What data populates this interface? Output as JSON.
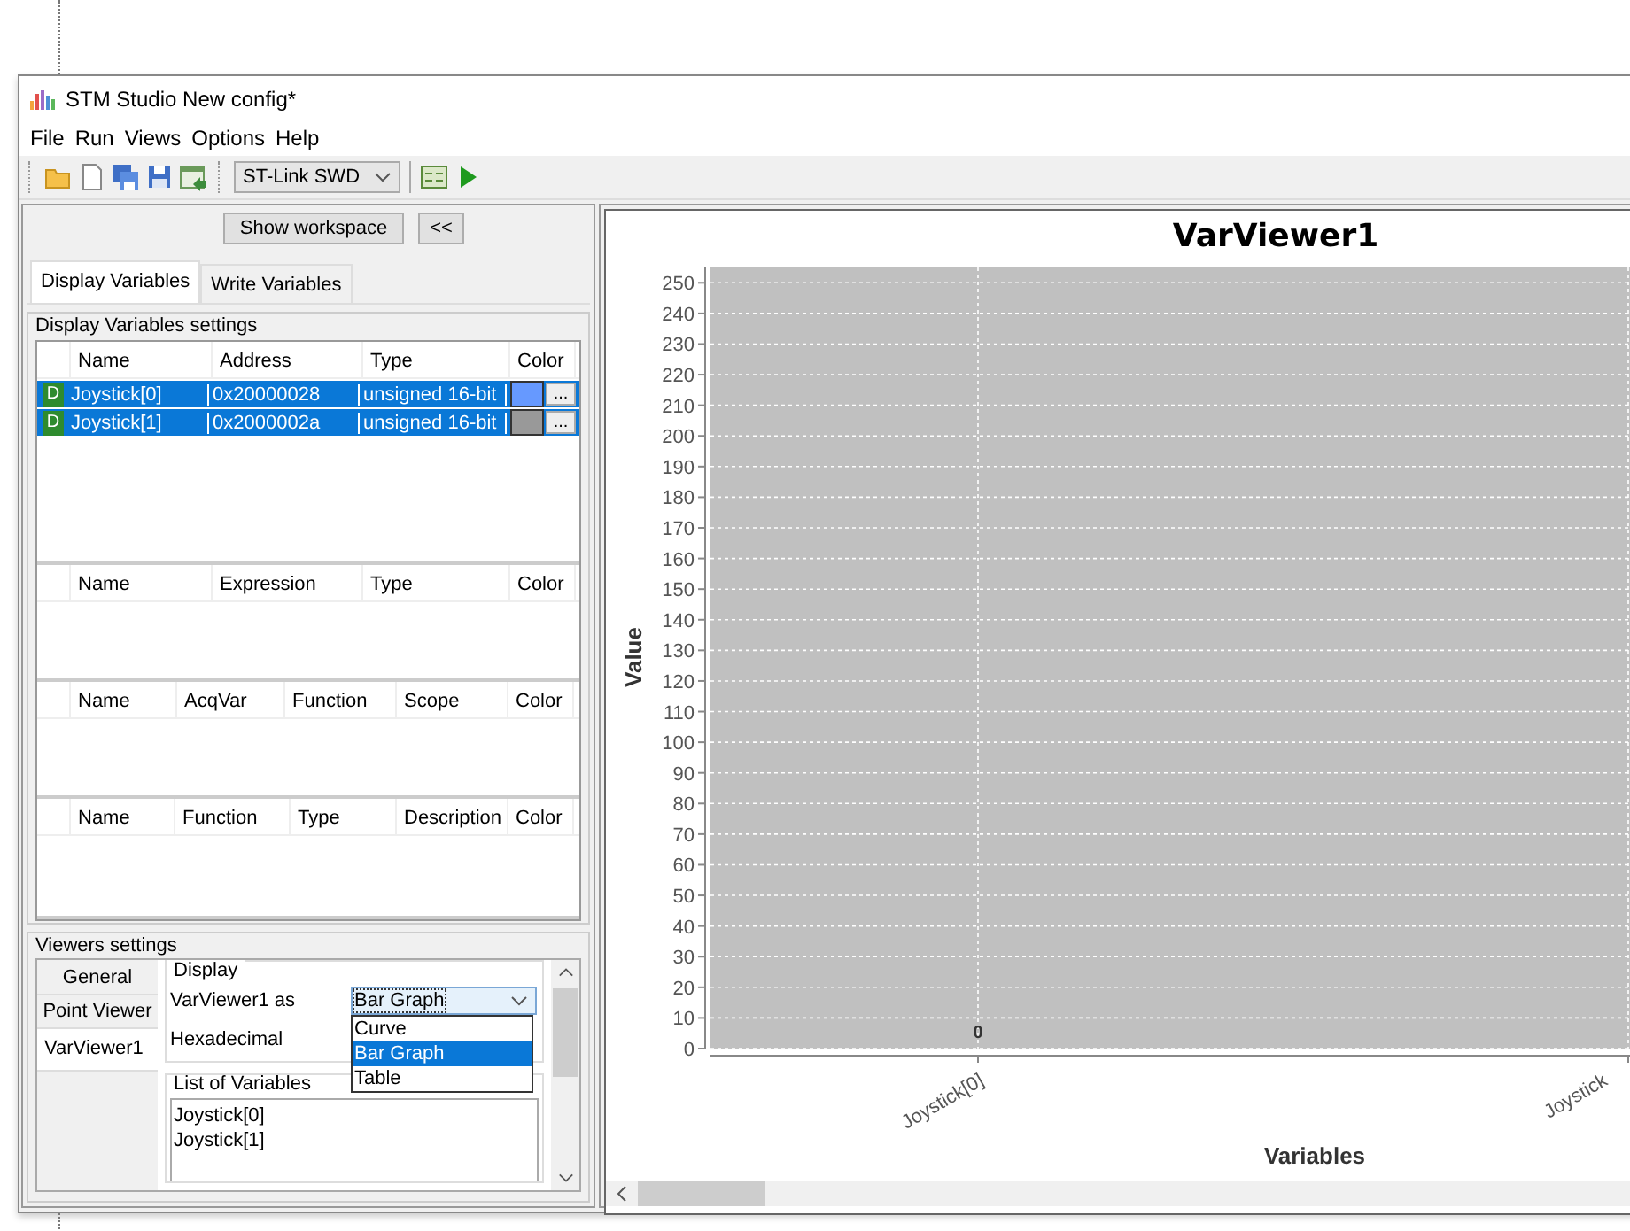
{
  "window": {
    "title": "STM Studio New config*"
  },
  "menu": [
    "File",
    "Run",
    "Views",
    "Options",
    "Help"
  ],
  "toolbar": {
    "probe": "ST-Link SWD"
  },
  "workspace": {
    "show_button": "Show workspace",
    "collapse_button": "<<"
  },
  "tabs": [
    {
      "label": "Display Variables",
      "selected": true
    },
    {
      "label": "Write Variables",
      "selected": false
    }
  ],
  "display_settings": {
    "title": "Display Variables settings",
    "tables": [
      {
        "columns": [
          "Name",
          "Address",
          "Type",
          "Color"
        ],
        "rows": [
          {
            "badge": "D",
            "name": "Joystick[0]",
            "address": "0x20000028",
            "type": "unsigned 16-bit",
            "color": "#6699ff",
            "button": "...",
            "selected": true
          },
          {
            "badge": "D",
            "name": "Joystick[1]",
            "address": "0x2000002a",
            "type": "unsigned 16-bit",
            "color": "#999999",
            "button": "...",
            "selected": true
          }
        ]
      },
      {
        "columns": [
          "Name",
          "Expression",
          "Type",
          "Color"
        ]
      },
      {
        "columns": [
          "Name",
          "AcqVar",
          "Function",
          "Scope",
          "Color"
        ]
      },
      {
        "columns": [
          "Name",
          "Function",
          "Type",
          "Description",
          "Color"
        ]
      }
    ]
  },
  "viewers": {
    "title": "Viewers settings",
    "tabs": [
      {
        "label": "General",
        "selected": false
      },
      {
        "label": "Point Viewer",
        "selected": false
      },
      {
        "label": "VarViewer1",
        "selected": true
      }
    ],
    "display": {
      "title": "Display",
      "as_label": "VarViewer1 as",
      "combo": "Bar Graph",
      "hex_label": "Hexadecimal",
      "options": [
        {
          "label": "Curve",
          "selected": false
        },
        {
          "label": "Bar Graph",
          "selected": true
        },
        {
          "label": "Table",
          "selected": false
        }
      ]
    },
    "variables": {
      "title": "List of Variables",
      "items": [
        "Joystick[0]",
        "Joystick[1]"
      ]
    }
  },
  "chart": {
    "chart_data": {
      "type": "bar",
      "title": "VarViewer1",
      "xlabel": "Variables",
      "ylabel": "Value",
      "categories": [
        "Joystick[0]",
        "Joystick"
      ],
      "values": [
        0,
        null
      ],
      "ylim": [
        0,
        255
      ],
      "yticks": [
        0,
        10,
        20,
        30,
        40,
        50,
        60,
        70,
        80,
        90,
        100,
        110,
        120,
        130,
        140,
        150,
        160,
        170,
        180,
        190,
        200,
        210,
        220,
        230,
        240,
        250
      ],
      "data_labels": true,
      "grid": true
    }
  }
}
